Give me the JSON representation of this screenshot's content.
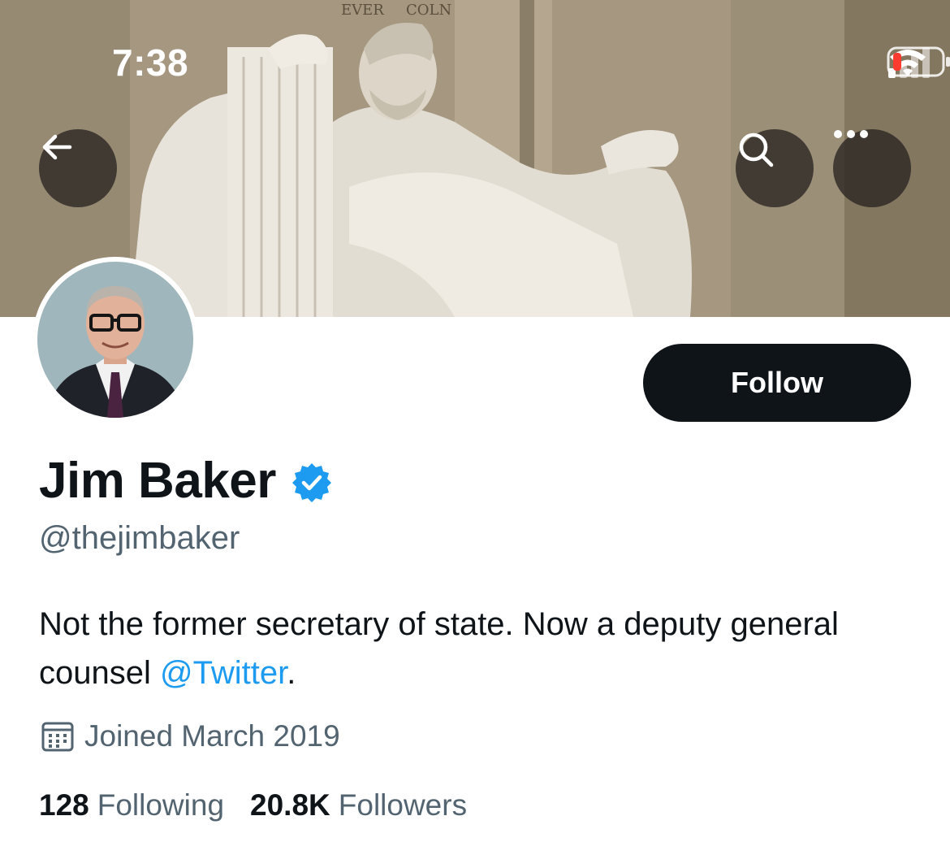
{
  "status_bar": {
    "time": "7:38",
    "icons": [
      "cellular-signal-icon",
      "wifi-icon",
      "battery-low-icon"
    ],
    "battery_color": "#ff3b30"
  },
  "banner": {
    "description_icon": "banner-image",
    "engraving_top": "COLN",
    "engraving_bottom": "EVER"
  },
  "nav": {
    "back_icon": "back-arrow-icon",
    "search_icon": "search-icon",
    "more_icon": "more-icon"
  },
  "profile": {
    "display_name": "Jim Baker",
    "verified_color": "#1d9bf0",
    "handle": "@thejimbaker",
    "bio_text": "Not the former secretary of state. Now a deputy general counsel ",
    "bio_mention": "@Twitter",
    "bio_end": ".",
    "joined": "Joined March 2019",
    "follow_label": "Follow"
  },
  "stats": {
    "following_count": "128",
    "following_label": "Following",
    "followers_count": "20.8K",
    "followers_label": "Followers"
  },
  "colors": {
    "accent": "#1d9bf0",
    "text_primary": "#0f1419",
    "text_secondary": "#536471"
  }
}
